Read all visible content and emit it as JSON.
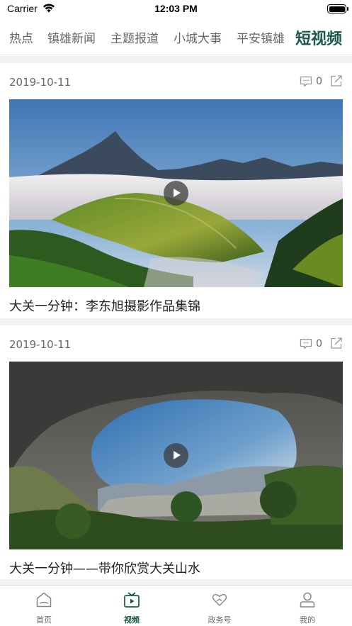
{
  "status_bar": {
    "carrier": "Carrier",
    "time": "12:03 PM"
  },
  "top_tabs": [
    {
      "label": "热点",
      "active": false
    },
    {
      "label": "镇雄新闻",
      "active": false
    },
    {
      "label": "主题报道",
      "active": false
    },
    {
      "label": "小城大事",
      "active": false
    },
    {
      "label": "平安镇雄",
      "active": false
    },
    {
      "label": "短视频",
      "active": true
    }
  ],
  "feed": [
    {
      "date": "2019-10-11",
      "comment_count": "0",
      "title": "大关一分钟：李东旭摄影作品集锦",
      "icons": {
        "comment": "comment-icon",
        "share": "share-icon",
        "play": "play-icon"
      }
    },
    {
      "date": "2019-10-11",
      "comment_count": "0",
      "title": "大关一分钟——带你欣赏大关山水",
      "icons": {
        "comment": "comment-icon",
        "share": "share-icon",
        "play": "play-icon"
      }
    }
  ],
  "bottom_nav": [
    {
      "label": "首页",
      "icon": "home-icon",
      "active": false
    },
    {
      "label": "视频",
      "icon": "tv-icon",
      "active": true
    },
    {
      "label": "政务号",
      "icon": "heart-hand-icon",
      "active": false
    },
    {
      "label": "我的",
      "icon": "person-icon",
      "active": false
    }
  ],
  "colors": {
    "accent": "#1b5a4a",
    "text_muted": "#666666",
    "divider": "#f2f2f2"
  }
}
